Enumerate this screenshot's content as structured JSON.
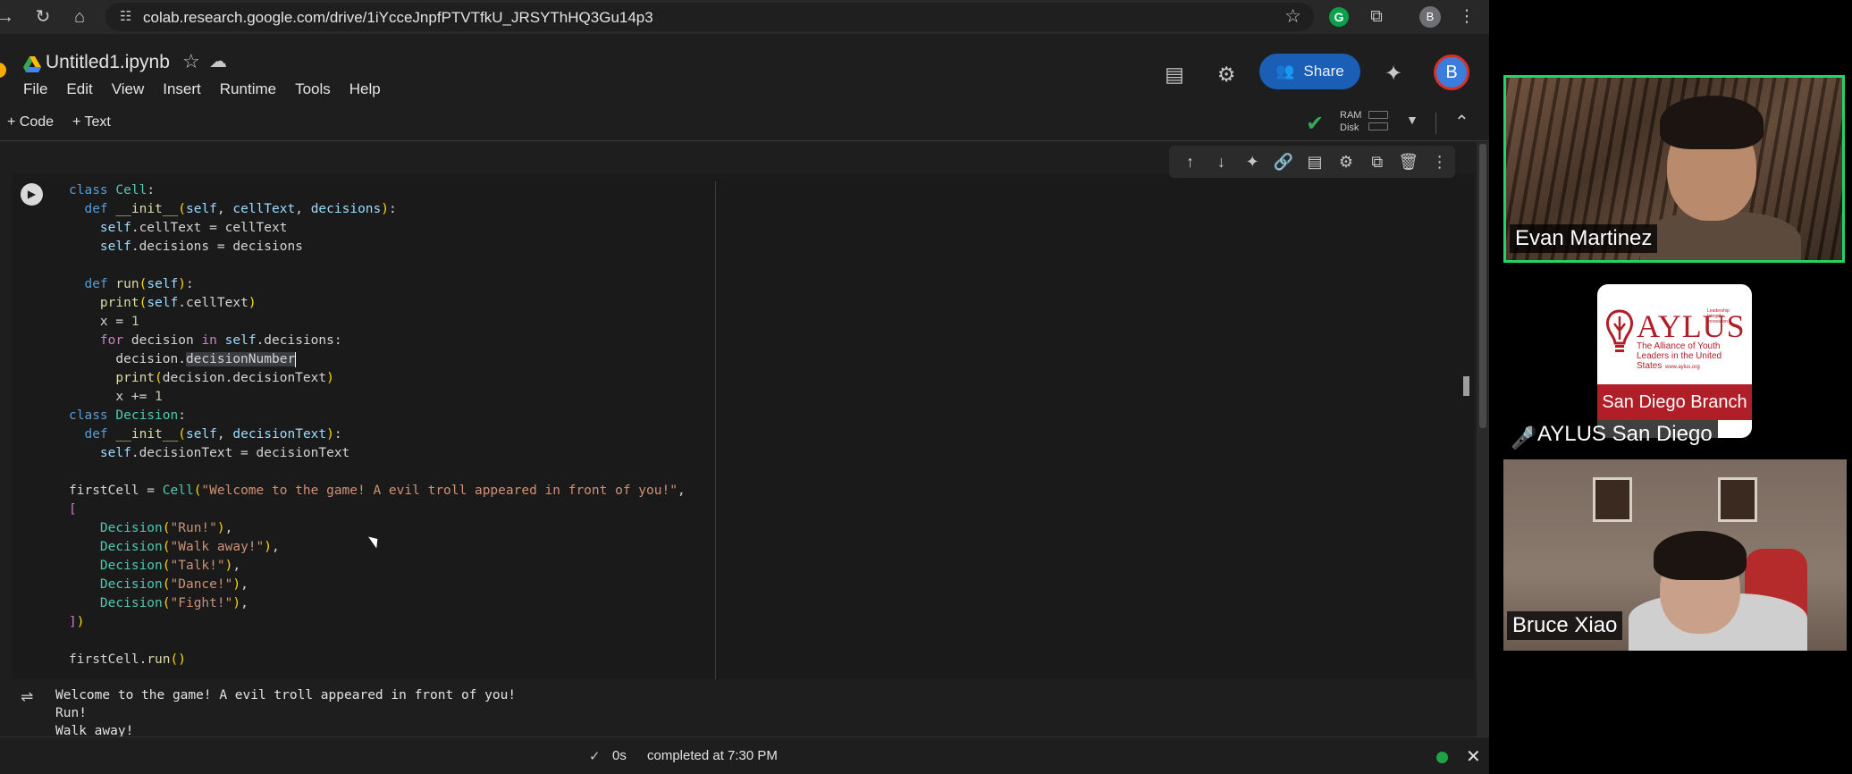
{
  "browser": {
    "url": "colab.research.google.com/drive/1iYcceJnpfPTVTfkU_JRSYThHQ3Gu14p3",
    "profile_initial": "B"
  },
  "colab": {
    "notebook_title": "Untitled1.ipynb",
    "menu": [
      "File",
      "Edit",
      "View",
      "Insert",
      "Runtime",
      "Tools",
      "Help"
    ],
    "share_label": "Share",
    "profile_initial": "B",
    "add_code_label": "+ Code",
    "add_text_label": "+ Text",
    "ram_label": "RAM",
    "disk_label": "Disk"
  },
  "code": {
    "lines": [
      "class Cell:",
      "  def __init__(self, cellText, decisions):",
      "    self.cellText = cellText",
      "    self.decisions = decisions",
      "",
      "  def run(self):",
      "    print(self.cellText)",
      "    x = 1",
      "    for decision in self.decisions:",
      "      decision.decisionNumber",
      "      print(decision.decisionText)",
      "      x += 1",
      "class Decision:",
      "  def __init__(self, decisionText):",
      "    self.decisionText = decisionText",
      "",
      "firstCell = Cell(\"Welcome to the game! A evil troll appeared in front of you!\",",
      "[",
      "    Decision(\"Run!\"),",
      "    Decision(\"Walk away!\"),",
      "    Decision(\"Talk!\"),",
      "    Decision(\"Dance!\"),",
      "    Decision(\"Fight!\"),",
      "])",
      "",
      "firstCell.run()"
    ]
  },
  "output": {
    "lines": [
      "Welcome to the game! A evil troll appeared in front of you!",
      "Run!",
      "Walk away!"
    ]
  },
  "status": {
    "time": "0s",
    "completed": "completed at 7:30 PM"
  },
  "participants": {
    "evan": "Evan Martinez",
    "aylus": "AYLUS San Diego",
    "bruce": "Bruce Xiao"
  },
  "aylus_logo": {
    "word": "AYLUS",
    "tagline": "The Alliance of Youth Leaders in the United States",
    "small": "Leadership Integrity Innovation",
    "url": "www.aylus.org",
    "branch": "San Diego Branch"
  },
  "colors": {
    "share_blue": "#1a5eb5",
    "active_speaker_green": "#24d366",
    "aylus_red": "#b01e28",
    "status_green": "#1ea446"
  }
}
